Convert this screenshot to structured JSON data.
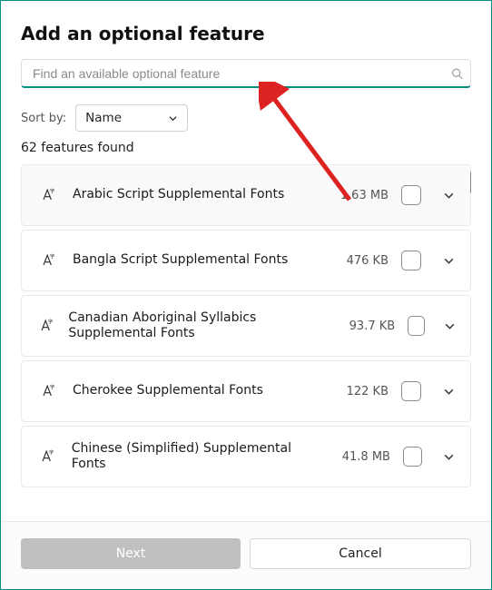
{
  "title": "Add an optional feature",
  "search": {
    "placeholder": "Find an available optional feature"
  },
  "sort": {
    "label": "Sort by:",
    "value": "Name"
  },
  "count_text": "62 features found",
  "features": [
    {
      "name": "Arabic Script Supplemental Fonts",
      "size": "1.63 MB"
    },
    {
      "name": "Bangla Script Supplemental Fonts",
      "size": "476 KB"
    },
    {
      "name": "Canadian Aboriginal Syllabics Supplemental Fonts",
      "size": "93.7 KB"
    },
    {
      "name": "Cherokee Supplemental Fonts",
      "size": "122 KB"
    },
    {
      "name": "Chinese (Simplified) Supplemental Fonts",
      "size": "41.8 MB"
    }
  ],
  "buttons": {
    "next": "Next",
    "cancel": "Cancel"
  }
}
